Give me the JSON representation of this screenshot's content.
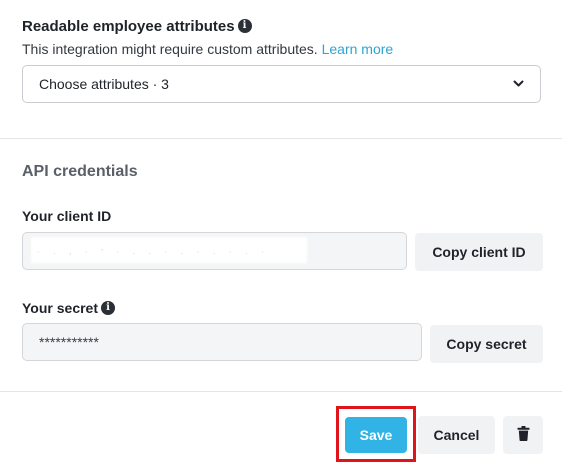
{
  "attributes": {
    "title": "Readable employee attributes",
    "title_info_icon": "info-icon",
    "helper_text": "This integration might require custom attributes.",
    "learn_more_link": "Learn more",
    "select_value": "Choose attributes · 3",
    "select_icon": "chevron-down-icon"
  },
  "credentials": {
    "heading": "API credentials",
    "client_id_label": "Your client ID",
    "client_id_value": "",
    "copy_client_id_label": "Copy client ID",
    "secret_label": "Your secret",
    "secret_info_icon": "info-icon",
    "secret_value": "***********",
    "copy_secret_label": "Copy secret"
  },
  "footer": {
    "save_label": "Save",
    "cancel_label": "Cancel",
    "delete_icon": "trash-icon"
  },
  "colors": {
    "accent": "#31b3e6",
    "link": "#2ba5d8",
    "highlight": "#e0151b"
  }
}
